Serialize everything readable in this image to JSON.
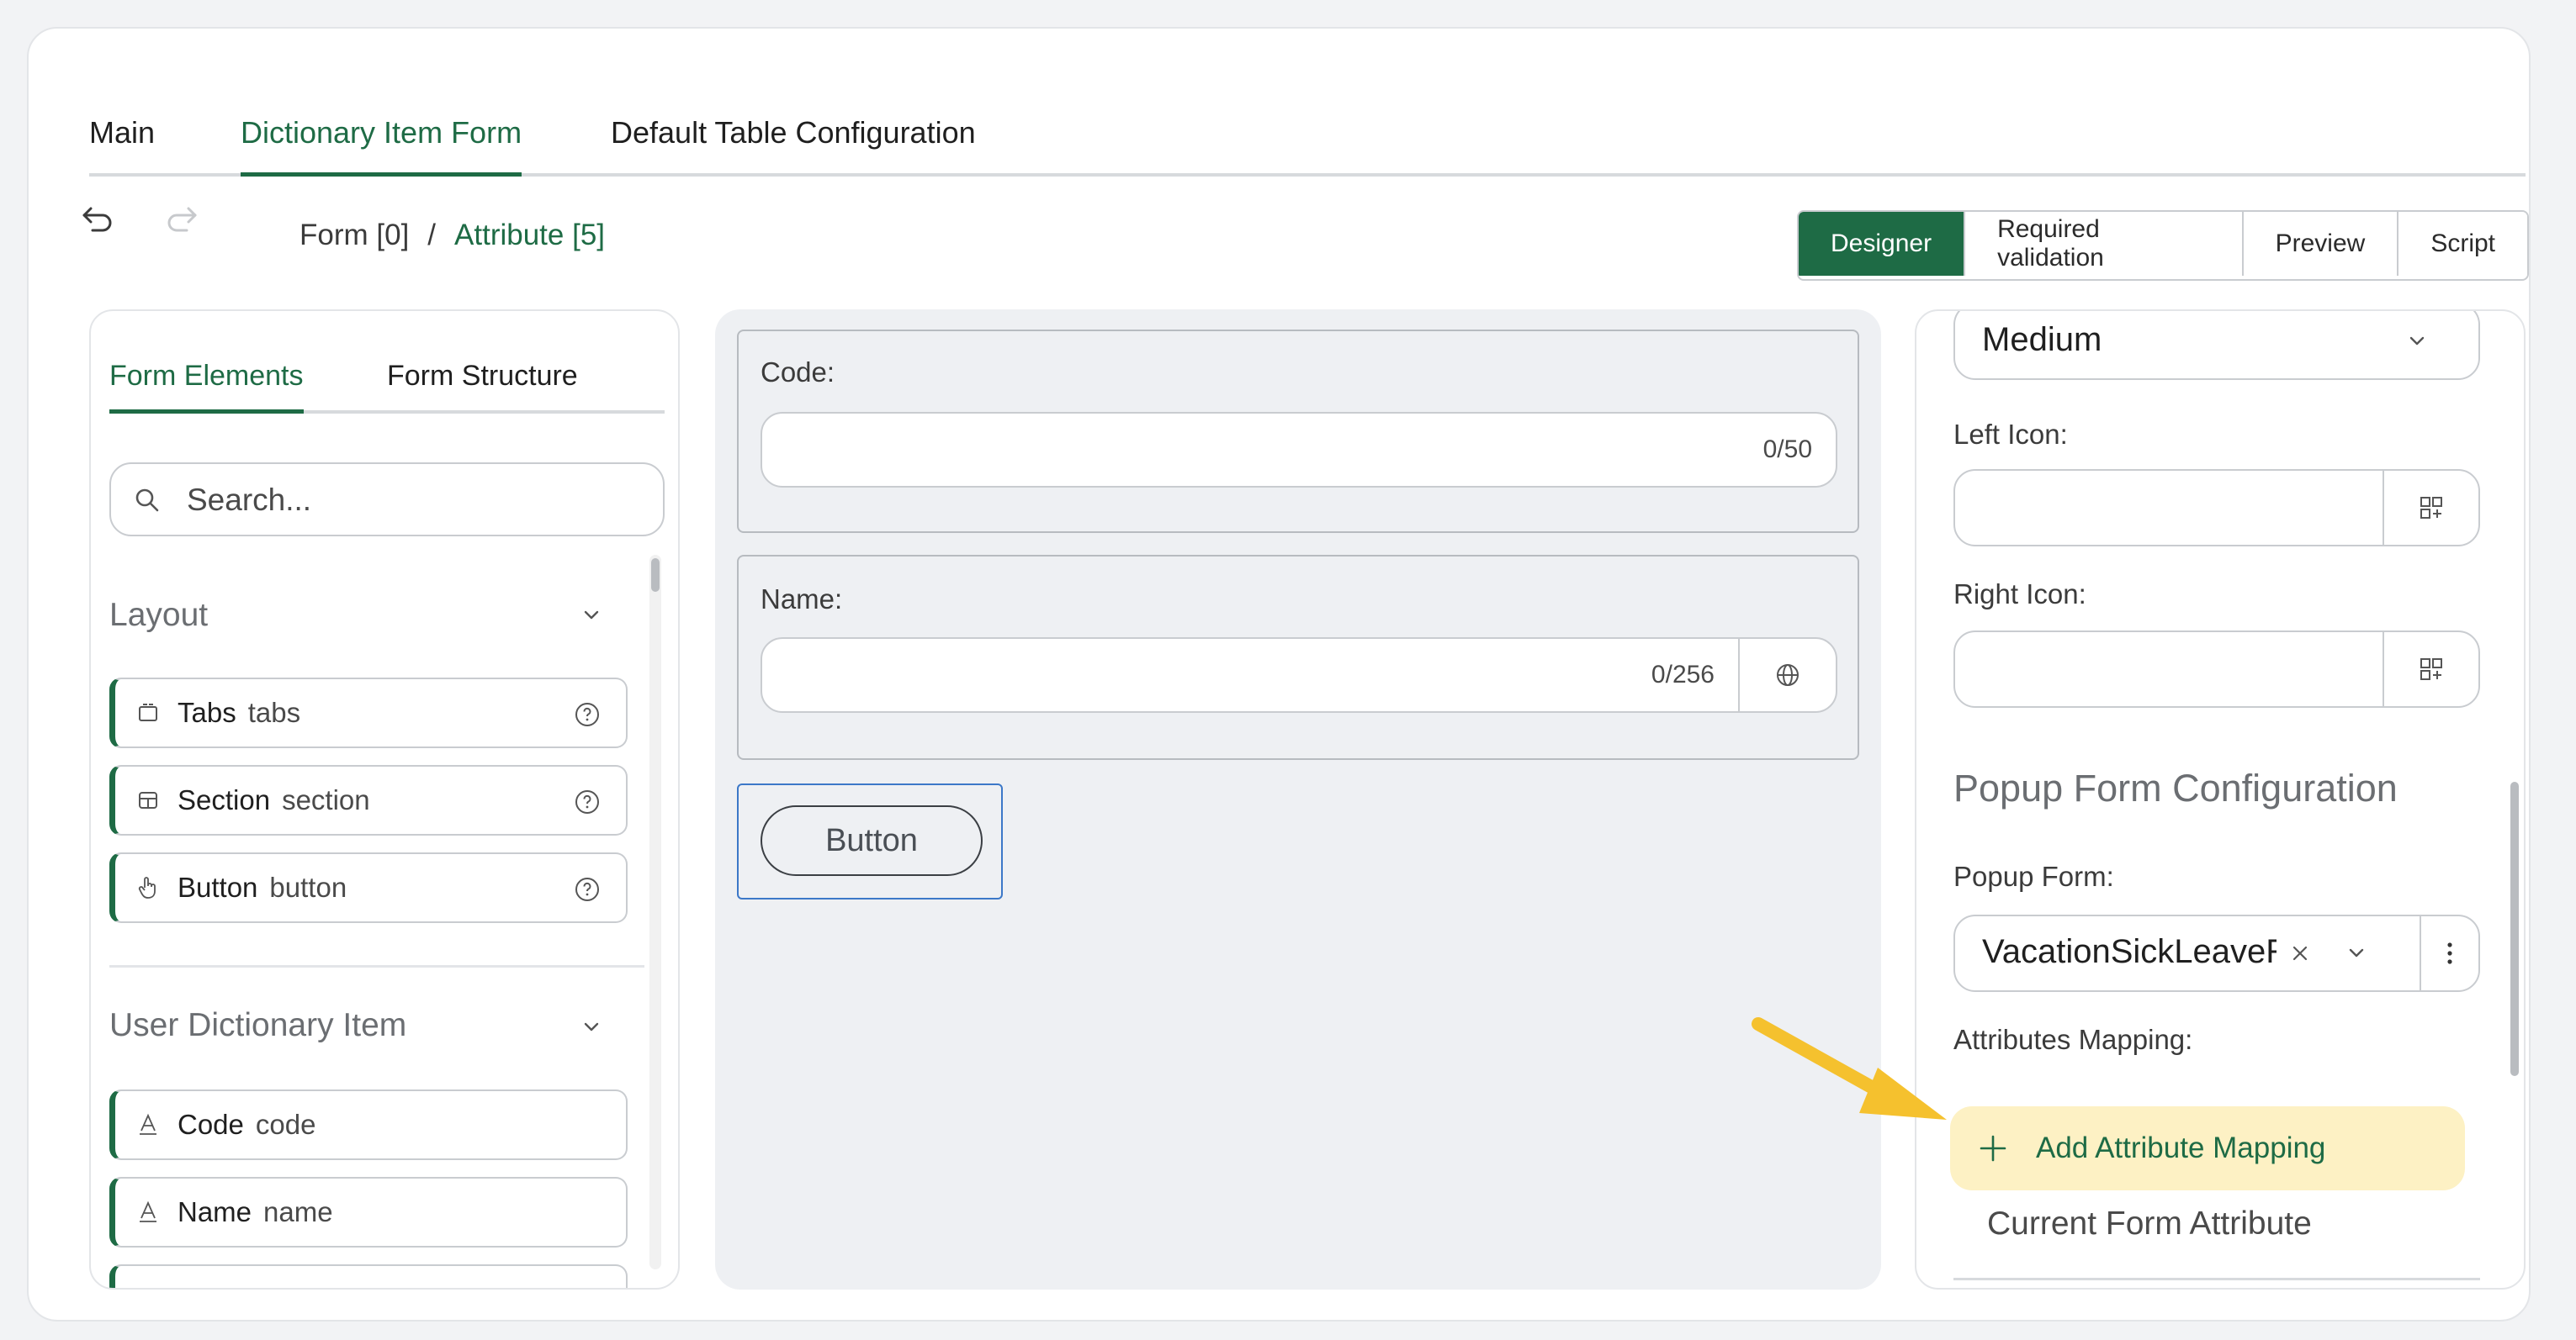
{
  "top_tabs": [
    "Main",
    "Dictionary Item Form",
    "Default Table Configuration"
  ],
  "toolbar": {
    "breadcrumb": {
      "root": "Form [0]",
      "separator": "/",
      "current": "Attribute [5]"
    },
    "modes": [
      "Designer",
      "Required validation",
      "Preview",
      "Script"
    ]
  },
  "left_panel": {
    "tabs": [
      "Form Elements",
      "Form Structure"
    ],
    "search_placeholder": "Search...",
    "groups": [
      {
        "title": "Layout",
        "items": [
          {
            "label": "Tabs",
            "key": "tabs"
          },
          {
            "label": "Section",
            "key": "section"
          },
          {
            "label": "Button",
            "key": "button"
          }
        ]
      },
      {
        "title": "User Dictionary Item",
        "items": [
          {
            "label": "Code",
            "key": "code"
          },
          {
            "label": "Name",
            "key": "name"
          }
        ]
      }
    ]
  },
  "canvas": {
    "code_field": {
      "label": "Code:",
      "counter": "0/50"
    },
    "name_field": {
      "label": "Name:",
      "counter": "0/256"
    },
    "button_label": "Button"
  },
  "right_panel": {
    "size_value": "Medium",
    "left_icon_label": "Left Icon:",
    "right_icon_label": "Right Icon:",
    "section_title": "Popup Form Configuration",
    "popup_form_label": "Popup Form:",
    "popup_form_value": "VacationSickLeaveR",
    "attributes_mapping_label": "Attributes Mapping:",
    "add_mapping_label": "Add Attribute Mapping",
    "column_header": "Current Form Attribute"
  },
  "colors": {
    "accent": "#1e6b45",
    "highlight": "#fdf1c4",
    "arrow": "#f5c12e"
  }
}
